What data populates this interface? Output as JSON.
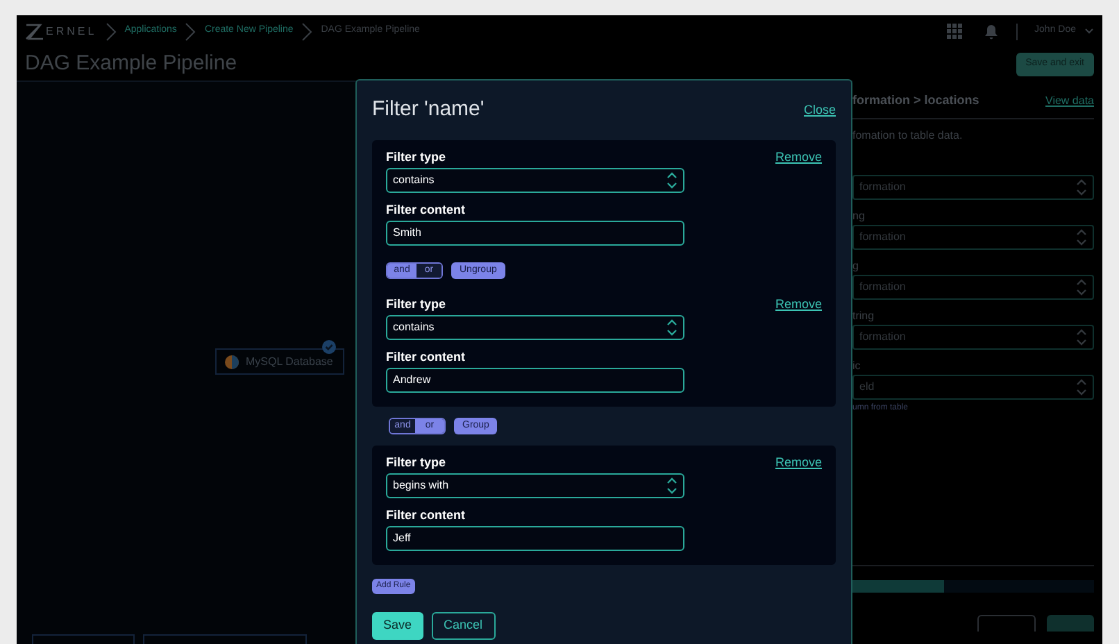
{
  "header": {
    "logo_text": "ERNEL",
    "breadcrumbs": [
      {
        "label": "Applications",
        "current": false
      },
      {
        "label": "Create New Pipeline",
        "current": false
      },
      {
        "label": "DAG Example Pipeline",
        "current": true
      }
    ],
    "user": "John Doe"
  },
  "page": {
    "title": "DAG Example Pipeline",
    "save_button": "Save and exit"
  },
  "canvas": {
    "node": {
      "label": "MySQL Database",
      "checked": true
    }
  },
  "side_panel": {
    "title": "formation > locations",
    "view_link": "View data",
    "description": "fomation to table data.",
    "fields": [
      {
        "value": "formation"
      },
      {
        "label": "ng",
        "value": "formation"
      },
      {
        "label": "g",
        "value": "formation"
      },
      {
        "label": "tring",
        "value": "formation"
      },
      {
        "label": "ic",
        "value": "eld"
      }
    ],
    "hint": "umn from table",
    "progress": {
      "level": 0.38
    }
  },
  "modal": {
    "title": "Filter 'name'",
    "close": "Close",
    "blocks": [
      {
        "kind": "group",
        "items": [
          {
            "kind": "rule",
            "type_label": "Filter type",
            "type": "contains",
            "content_label": "Filter content",
            "content": "Smith",
            "remove": "Remove"
          },
          {
            "kind": "connector",
            "options": [
              {
                "label": "and",
                "selected": true
              },
              {
                "label": "or",
                "selected": false
              }
            ],
            "action": "Ungroup"
          },
          {
            "kind": "rule",
            "type_label": "Filter type",
            "type": "contains",
            "content_label": "Filter content",
            "content": "Andrew",
            "remove": "Remove"
          }
        ]
      },
      {
        "kind": "connector",
        "options": [
          {
            "label": "and",
            "selected": false
          },
          {
            "label": "or",
            "selected": true
          }
        ],
        "action": "Group"
      },
      {
        "kind": "group",
        "items": [
          {
            "kind": "rule",
            "type_label": "Filter type",
            "type": "begins with",
            "content_label": "Filter content",
            "content": "Jeff",
            "remove": "Remove"
          }
        ]
      }
    ],
    "add_rule": "Add Rule",
    "save": "Save",
    "cancel": "Cancel"
  }
}
